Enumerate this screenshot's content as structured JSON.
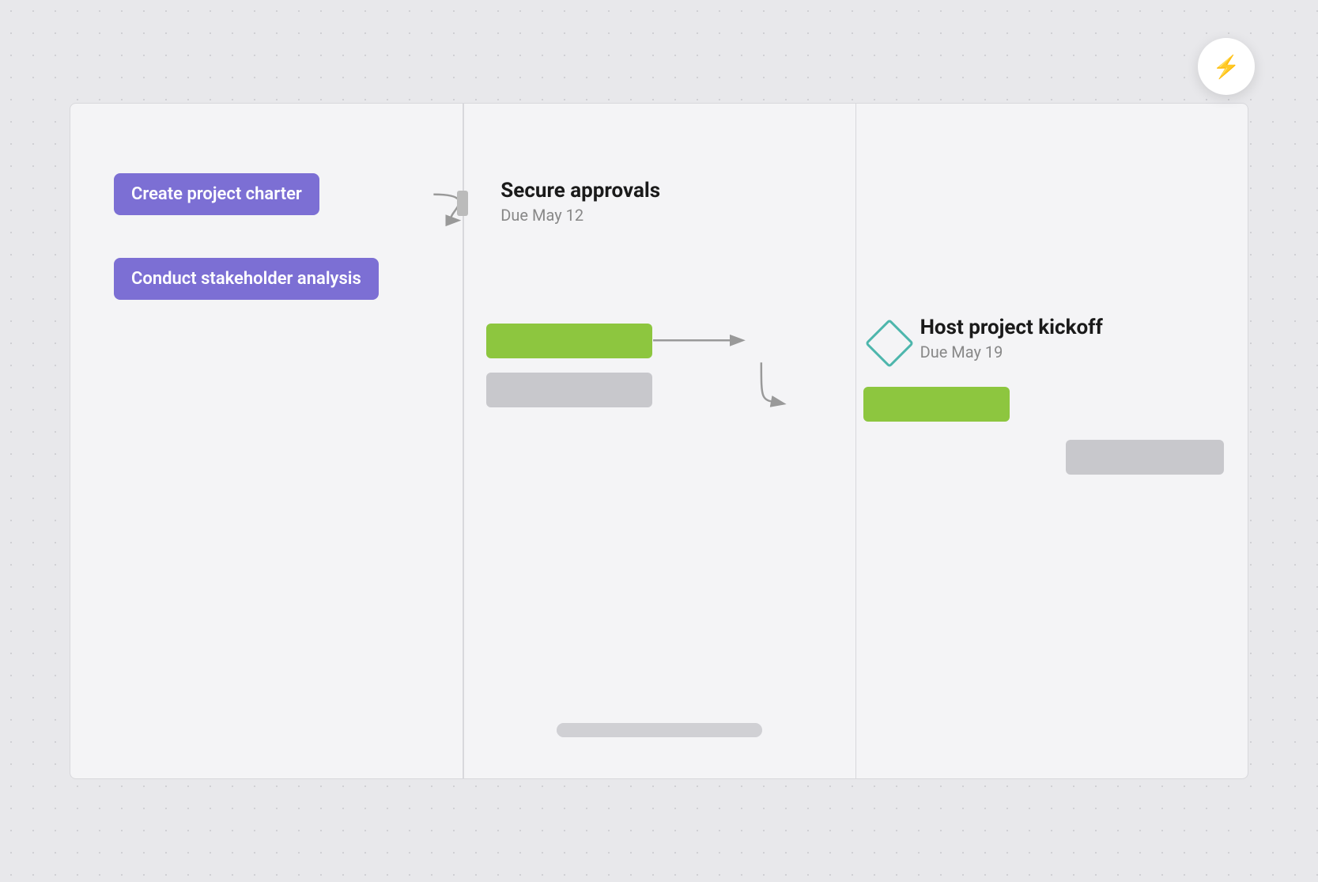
{
  "lightning_button": {
    "label": "⚡",
    "aria": "Quick actions"
  },
  "tasks": {
    "charter": {
      "label": "Create project charter"
    },
    "stakeholder": {
      "label": "Conduct stakeholder analysis"
    }
  },
  "milestones": {
    "secure_approvals": {
      "title": "Secure approvals",
      "due": "Due May 12"
    },
    "host_kickoff": {
      "title": "Host project kickoff",
      "due": "Due May 19"
    }
  },
  "scrollbar": {
    "label": "horizontal scrollbar"
  },
  "colors": {
    "purple": "#7c6fd4",
    "green": "#8dc63f",
    "gray_bar": "#c8c8cc",
    "teal": "#4db6ac",
    "background": "#e8e8eb",
    "gantt_bg": "#f4f4f6",
    "lightning": "#f5a623"
  }
}
